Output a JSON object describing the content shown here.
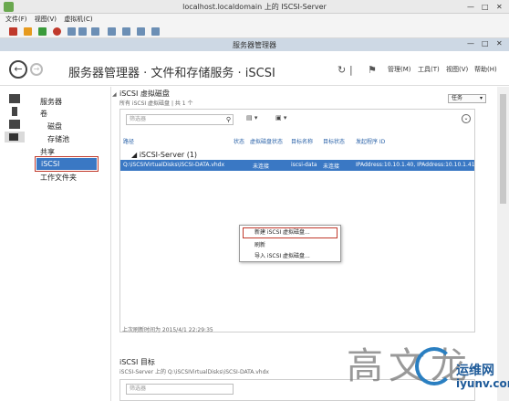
{
  "vm": {
    "title": "localhost.localdomain 上的 ISCSI-Server",
    "window_buttons": [
      "—",
      "□",
      "✕"
    ],
    "menu": [
      "文件(F)",
      "视图(V)",
      "虚拟机(C)"
    ]
  },
  "sm": {
    "title": "服务器管理器",
    "window_buttons": [
      "—",
      "□",
      "✕"
    ]
  },
  "header": {
    "breadcrumb": "服务器管理器 · 文件和存储服务 · iSCSI",
    "menus": [
      "管理(M)",
      "工具(T)",
      "视图(V)",
      "帮助(H)"
    ]
  },
  "sidebar": {
    "items": [
      "服务器",
      "卷",
      "磁盘",
      "存储池",
      "共享",
      "iSCSI",
      "工作文件夹"
    ]
  },
  "vdisk": {
    "title": "iSCSI 虚拟磁盘",
    "subtitle": "所有 iSCSI 虚拟磁盘 | 共 1 个",
    "tasks_label": "任务",
    "filter_placeholder": "筛选器",
    "columns": [
      "路径",
      "状态",
      "虚拟磁盘状态",
      "目标名称",
      "目标状态",
      "发起程序 ID"
    ],
    "group": "iSCSI-Server (1)",
    "row": {
      "path": "Q:\\iSCSIVirtualDisks\\iSCSI-DATA.vhdx",
      "vdisk_status": "未连接",
      "target_name": "iscsi-data",
      "target_status": "未连接",
      "initiator": "IPAddress:10.10.1.40, IPAddress:10.10.1.41"
    },
    "last_refreshed": "上次刷新时间为 2015/4/1 22:29:35"
  },
  "context_menu": {
    "items": [
      "新建 iSCSI 虚拟磁盘...",
      "刷新",
      "导入 iSCSI 虚拟磁盘..."
    ]
  },
  "target": {
    "title": "iSCSI 目标",
    "subtitle": "iSCSI-Server 上的 Q:\\iSCSIVirtualDisks\\iSCSI-DATA.vhdx"
  },
  "watermark": {
    "chars": "高文龙",
    "brand": "运维网",
    "url": "iyunv.com"
  },
  "colors": {
    "selection": "#3a78c4",
    "highlight_border": "#c0392b",
    "title_bar": "#cdd8e4"
  }
}
